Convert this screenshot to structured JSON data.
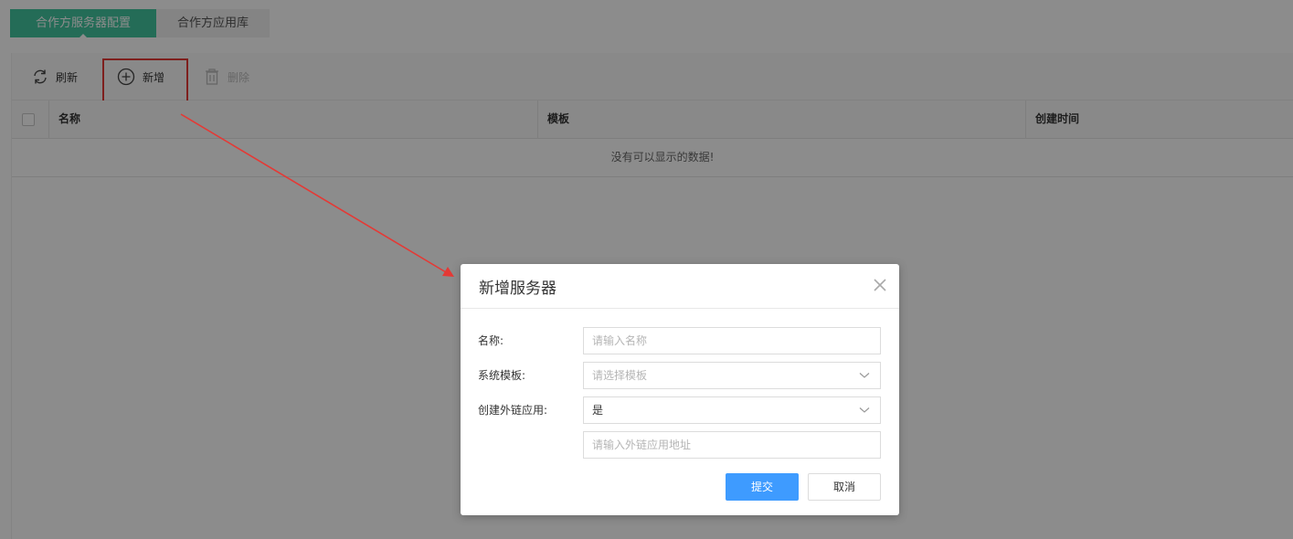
{
  "tabs": [
    {
      "label": "合作方服务器配置",
      "active": true
    },
    {
      "label": "合作方应用库",
      "active": false
    }
  ],
  "toolbar": {
    "refresh_label": "刷新",
    "add_label": "新增",
    "delete_label": "删除"
  },
  "table": {
    "columns": [
      "名称",
      "模板",
      "创建时间"
    ],
    "empty_text": "没有可以显示的数据!"
  },
  "dialog": {
    "title": "新增服务器",
    "fields": {
      "name_label": "名称:",
      "name_placeholder": "请输入名称",
      "template_label": "系统模板:",
      "template_placeholder": "请选择模板",
      "create_link_label": "创建外链应用:",
      "create_link_value": "是",
      "link_url_placeholder": "请输入外链应用地址"
    },
    "submit_label": "提交",
    "cancel_label": "取消"
  },
  "colors": {
    "tab_active": "#43c59e",
    "primary_button": "#3e9bff",
    "highlight": "#e53935"
  }
}
